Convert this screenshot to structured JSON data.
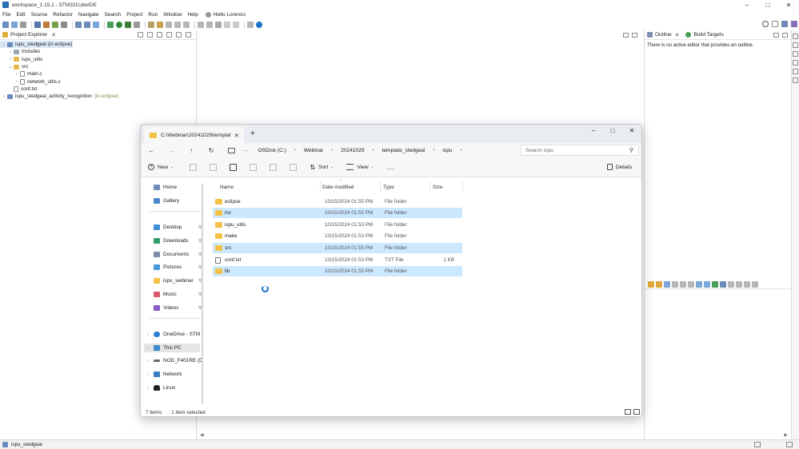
{
  "ide": {
    "title": "workspace_1.15.1 - STM32CubeIDE",
    "menu": [
      "File",
      "Edit",
      "Source",
      "Refactor",
      "Navigate",
      "Search",
      "Project",
      "Run",
      "Window",
      "Help"
    ],
    "user": "Hello Lorenzo",
    "project_explorer": {
      "tab_label": "Project Explorer",
      "tree": [
        {
          "label": "ispu_stedgeai",
          "suffix": "(in eclipse)",
          "icon": "project-icon",
          "expanded": true,
          "level": 0,
          "selected": true
        },
        {
          "label": "Includes",
          "icon": "includes-icon",
          "level": 1
        },
        {
          "label": "ispu_utils",
          "icon": "folder-icon",
          "level": 1
        },
        {
          "label": "src",
          "icon": "folder-icon",
          "level": 1,
          "expanded": true
        },
        {
          "label": "main.c",
          "icon": "c-file-icon",
          "level": 2
        },
        {
          "label": "network_utils.c",
          "icon": "c-file-icon",
          "level": 2
        },
        {
          "label": "conf.txt",
          "icon": "text-file-icon",
          "level": 1
        },
        {
          "label": "ispu_stedgeai_activity_recognition",
          "suffix": "(in eclipse)",
          "icon": "project-icon",
          "level": 0
        }
      ]
    },
    "outline": {
      "tab_label": "Outline",
      "build_targets_label": "Build Targets",
      "message": "There is no active editor that provides an outline."
    },
    "status_text": "ispu_stedgeai"
  },
  "explorer": {
    "tab_title": "C:\\Webinar\\20241029\\templat",
    "breadcrumbs": [
      "OSDisk (C:)",
      "Webinar",
      "20241029",
      "template_stedgeai",
      "ispu"
    ],
    "search_placeholder": "Search ispu",
    "commands": {
      "new": "New",
      "sort": "Sort",
      "view": "View",
      "more": "...",
      "details": "Details"
    },
    "nav": [
      {
        "label": "Home",
        "icon": "home-icon"
      },
      {
        "label": "Gallery",
        "icon": "gallery-icon"
      },
      {
        "label": "Desktop",
        "icon": "desktop-icon",
        "pinned": true
      },
      {
        "label": "Downloads",
        "icon": "downloads-icon",
        "pinned": true
      },
      {
        "label": "Documents",
        "icon": "documents-icon",
        "pinned": true
      },
      {
        "label": "Pictures",
        "icon": "pictures-icon",
        "pinned": true
      },
      {
        "label": "ispu_webinar",
        "icon": "folder-icon",
        "pinned": true
      },
      {
        "label": "Music",
        "icon": "music-icon",
        "pinned": true
      },
      {
        "label": "Videos",
        "icon": "videos-icon",
        "pinned": true
      },
      {
        "label": "OneDrive - STM",
        "icon": "onedrive-icon",
        "expandable": true
      },
      {
        "label": "This PC",
        "icon": "this-pc-icon",
        "expandable": true,
        "selected": true
      },
      {
        "label": "NOD_F401RE (D",
        "icon": "drive-icon",
        "expandable": true
      },
      {
        "label": "Network",
        "icon": "network-icon",
        "expandable": true
      },
      {
        "label": "Linux",
        "icon": "linux-icon",
        "expandable": true
      }
    ],
    "columns": {
      "name": "Name",
      "date": "Date modified",
      "type": "Type",
      "size": "Size"
    },
    "files": [
      {
        "name": "eclipse",
        "date": "10/15/2024 01:55 PM",
        "type": "File folder",
        "size": "",
        "icon": "folder-icon",
        "selected": false
      },
      {
        "name": "inc",
        "date": "10/15/2024 01:55 PM",
        "type": "File folder",
        "size": "",
        "icon": "folder-icon",
        "selected": true
      },
      {
        "name": "ispu_utils",
        "date": "10/15/2024 01:53 PM",
        "type": "File folder",
        "size": "",
        "icon": "folder-icon",
        "selected": false
      },
      {
        "name": "make",
        "date": "10/15/2024 01:53 PM",
        "type": "File folder",
        "size": "",
        "icon": "folder-icon",
        "selected": false
      },
      {
        "name": "src",
        "date": "10/15/2024 01:55 PM",
        "type": "File folder",
        "size": "",
        "icon": "folder-icon",
        "selected": true
      },
      {
        "name": "conf.txt",
        "date": "10/15/2024 01:53 PM",
        "type": "TXT File",
        "size": "1 KB",
        "icon": "text-file-icon",
        "selected": false
      },
      {
        "name": "lib",
        "date": "10/15/2024 01:55 PM",
        "type": "File folder",
        "size": "",
        "icon": "folder-icon",
        "selected": true
      }
    ],
    "status": {
      "items": "7 items",
      "selection": "1 item selected"
    }
  },
  "colors": {
    "selection": "#cce8ff",
    "folder": "#f4c245",
    "accent": "#1a73c9",
    "tree_selection": "#dbe9f7"
  }
}
